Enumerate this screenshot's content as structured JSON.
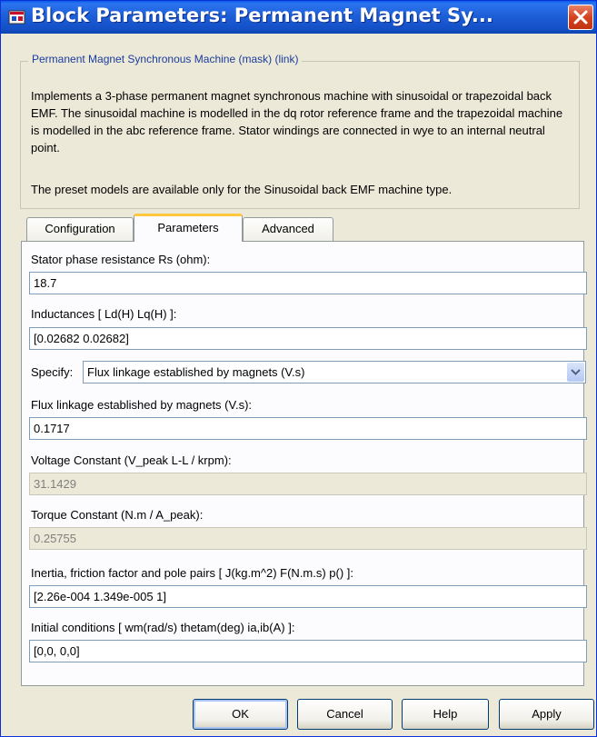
{
  "window": {
    "title": "Block Parameters: Permanent Magnet Sy..."
  },
  "mask": {
    "legend": "Permanent Magnet Synchronous Machine (mask) (link)",
    "description": "Implements a 3-phase permanent magnet synchronous machine with sinusoidal or trapezoidal back EMF. The sinusoidal machine is modelled in the dq rotor reference frame and the trapezoidal machine is modelled in the abc reference frame. Stator windings are connected in wye to an internal neutral point.",
    "note": "The preset models are available only for the Sinusoidal back EMF machine type."
  },
  "tabs": [
    {
      "label": "Configuration",
      "active": false
    },
    {
      "label": "Parameters",
      "active": true
    },
    {
      "label": "Advanced",
      "active": false
    }
  ],
  "params": {
    "rs_label": "Stator phase resistance Rs (ohm):",
    "rs_value": "18.7",
    "ind_label": "Inductances [ Ld(H) Lq(H) ]:",
    "ind_value": "[0.02682 0.02682]",
    "specify_label": "Specify:",
    "specify_value": "Flux linkage established by magnets (V.s)",
    "flux_label": "Flux linkage established by magnets (V.s):",
    "flux_value": "0.1717",
    "voltage_label": "Voltage Constant (V_peak L-L / krpm):",
    "voltage_value": "31.1429",
    "torque_label": "Torque Constant (N.m / A_peak):",
    "torque_value": "0.25755",
    "inertia_label": "Inertia, friction factor and pole pairs [ J(kg.m^2)  F(N.m.s)  p() ]:",
    "inertia_value": "[2.26e-004 1.349e-005 1]",
    "init_label": "Initial conditions  [ wm(rad/s)  thetam(deg)  ia,ib(A) ]:",
    "init_value": "[0,0, 0,0]"
  },
  "buttons": {
    "ok": "OK",
    "cancel": "Cancel",
    "help": "Help",
    "apply": "Apply"
  },
  "icons": {
    "app": "simulink-block-icon",
    "close": "close-icon",
    "dropdown": "chevron-down-icon"
  }
}
